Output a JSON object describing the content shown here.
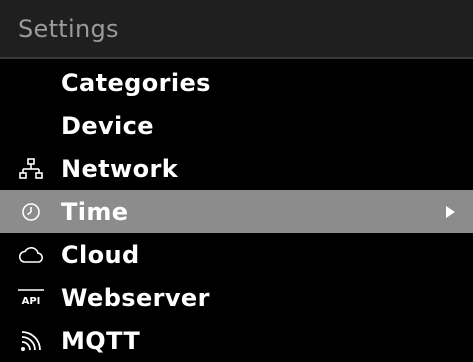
{
  "header": {
    "title": "Settings"
  },
  "menu": {
    "items": [
      {
        "label": "Categories",
        "icon": "none"
      },
      {
        "label": "Device",
        "icon": "none"
      },
      {
        "label": "Network",
        "icon": "network-icon"
      },
      {
        "label": "Time",
        "icon": "clock-icon",
        "selected": true
      },
      {
        "label": "Cloud",
        "icon": "cloud-icon"
      },
      {
        "label": "Webserver",
        "icon": "api-icon"
      },
      {
        "label": "MQTT",
        "icon": "wifi-signal-icon"
      }
    ]
  },
  "colors": {
    "background": "#000000",
    "header_bg": "#1f1f1f",
    "header_text": "#9a9a9a",
    "selected_bg": "#8c8c8c",
    "text": "#ffffff"
  }
}
